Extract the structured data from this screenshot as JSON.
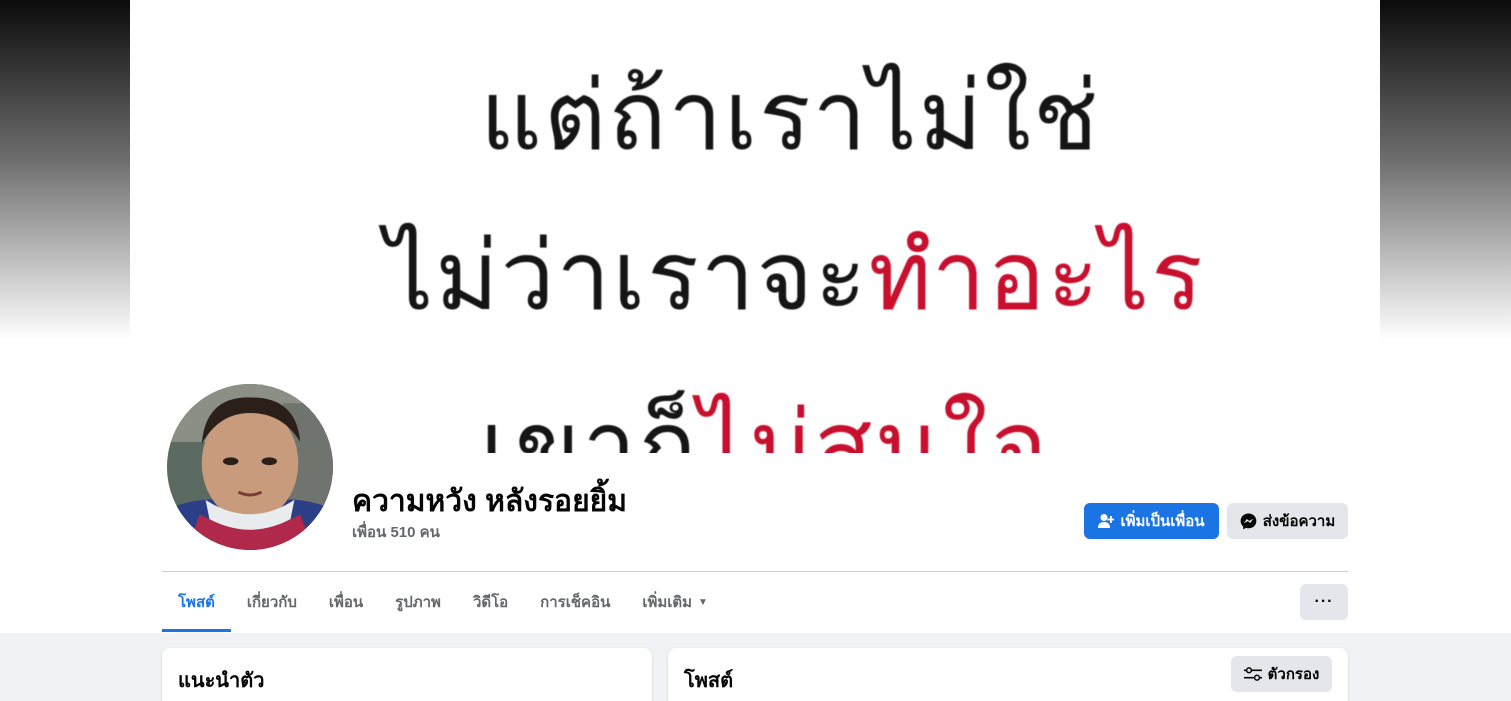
{
  "cover": {
    "line1": "แต่ถ้าเราไม่ใช่",
    "line2_black": "ไม่ว่าเราจะ",
    "line2_red": "ทำอะไร",
    "line3_black": "เขาก็",
    "line3_red": "ไม่สนใจ"
  },
  "profile": {
    "name": "ความหวัง หลังรอยยิ้ม",
    "friends": "เพื่อน 510 คน",
    "avatar_icon": "profile-photo"
  },
  "actions": {
    "add_friend_label": "เพิ่มเป็นเพื่อน",
    "add_friend_icon": "add-friend-icon",
    "message_label": "ส่งข้อความ",
    "message_icon": "messenger-icon",
    "more_label": "···"
  },
  "tabs": [
    {
      "label": "โพสต์",
      "active": true
    },
    {
      "label": "เกี่ยวกับ",
      "active": false
    },
    {
      "label": "เพื่อน",
      "active": false
    },
    {
      "label": "รูปภาพ",
      "active": false
    },
    {
      "label": "วิดีโอ",
      "active": false
    },
    {
      "label": "การเช็คอิน",
      "active": false
    },
    {
      "label": "เพิ่มเติม",
      "active": false
    }
  ],
  "intro": {
    "title": "แนะนำตัว"
  },
  "posts": {
    "title": "โพสต์",
    "filter_label": "ตัวกรอง",
    "filter_icon": "filter-sliders-icon"
  },
  "colors": {
    "accent": "#1b74e4",
    "button_gray": "#e4e6eb",
    "background": "#f0f2f5",
    "cover_red": "#c8102e"
  }
}
